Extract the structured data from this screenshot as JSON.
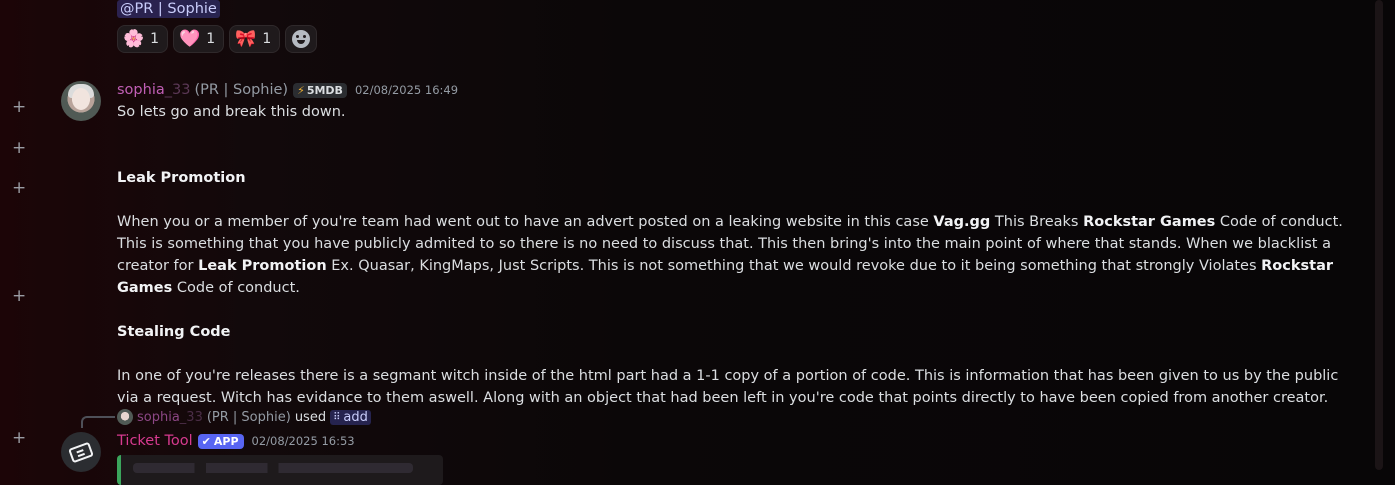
{
  "previous_message": {
    "mention": "@PR | Sophie",
    "reactions": [
      {
        "emoji": "🌸",
        "count": "1"
      },
      {
        "emoji": "🩷",
        "count": "1"
      },
      {
        "emoji": "🎀",
        "count": "1"
      }
    ]
  },
  "message": {
    "username_visible": "sophia",
    "username_faded": "_33",
    "nickname": "(PR | Sophie)",
    "tag": "5MDB",
    "timestamp": "02/08/2025 16:49",
    "line1": "So lets go and break this down.",
    "heading1": "Leak Promotion",
    "para1": {
      "t1": "When you or a member of you're team had went out to have an advert posted on a leaking website in this case ",
      "b1": "Vag.gg",
      "t2": " This Breaks ",
      "b2": "Rockstar Games",
      "t3": " Code of conduct. This is something that you have publicly admited to so there is no need to discuss that. This then bring's into the main point of where that stands. When we blacklist a creator for ",
      "b3": "Leak Promotion",
      "t4": " Ex. Quasar, KingMaps, Just Scripts. This is not something that we would revoke due to it being something that strongly Violates ",
      "b4": "Rockstar Games",
      "t5": " Code of conduct."
    },
    "heading2": "Stealing Code",
    "para2": "In one of you're releases there is a segmant witch inside of the html part had a 1-1 copy of a portion of code. This is information that has been given to us by the public via a request. Witch has evidance to them aswell. Along with an object that had been left in you're code that points directly to have been copied from another creator."
  },
  "reply": {
    "username_visible": "sophia",
    "username_faded": "_33",
    "nickname": "(PR | Sophie)",
    "used": "used",
    "command": "add"
  },
  "bot_message": {
    "name": "Ticket Tool",
    "badge": "APP",
    "timestamp": "02/08/2025 16:53"
  },
  "icons": {
    "add_row": "plus-icon",
    "add_reaction": "smiley-icon",
    "bot_avatar": "ticket-icon"
  },
  "colors": {
    "username": "#c05fb5",
    "bot_name": "#d63a8f",
    "mention_bg": "#3b3f7a",
    "embed_border": "#3ba55c",
    "app_badge": "#5865f2"
  }
}
